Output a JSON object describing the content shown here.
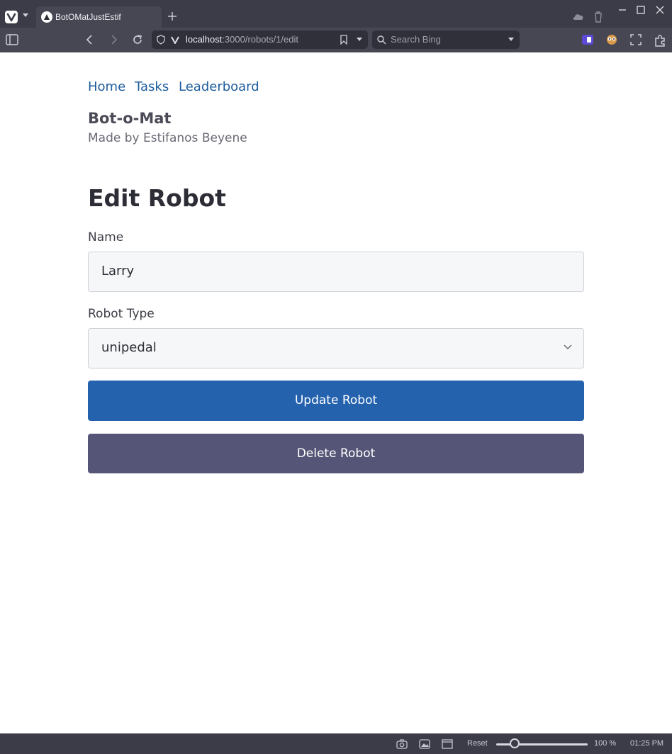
{
  "browser": {
    "tab_title": "BotOMatJustEstif",
    "url_host": "localhost",
    "url_path": ":3000/robots/1/edit",
    "search_placeholder": "Search Bing"
  },
  "nav": {
    "links": [
      "Home",
      "Tasks",
      "Leaderboard"
    ]
  },
  "brand": {
    "title": "Bot-o-Mat",
    "subtitle": "Made by Estifanos Beyene"
  },
  "form": {
    "heading": "Edit Robot",
    "name_label": "Name",
    "name_value": "Larry",
    "type_label": "Robot Type",
    "type_value": "unipedal",
    "update_label": "Update Robot",
    "delete_label": "Delete Robot"
  },
  "statusbar": {
    "reset_label": "Reset",
    "zoom_label": "100 %",
    "zoom_level": 0.2,
    "clock": "01:25 PM"
  },
  "colors": {
    "link": "#1d5d9e",
    "primary_button": "#2462ae",
    "secondary_button": "#555677"
  }
}
